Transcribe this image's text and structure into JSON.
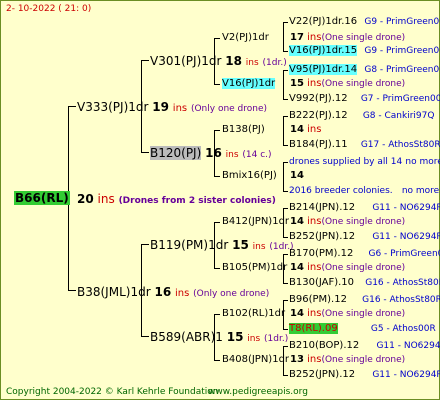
{
  "header": {
    "date": "2- 10-2022 ( 21: 0)"
  },
  "footer": {
    "copyright": "Copyright 2004-2022 © Karl Kehrle Foundation",
    "url": "www.pedigreeapis.org"
  },
  "g1": {
    "name": "B66(RL)",
    "num": "20",
    "ins": "ins",
    "note": "(Drones from 2 sister colonies)"
  },
  "g2": [
    {
      "name": "V333(PJ)1dr",
      "num": "19",
      "ins": "ins",
      "note": "(Only one drone)"
    },
    {
      "name": "B38(JML)1dr",
      "num": "16",
      "ins": "ins",
      "note": "(Only one drone)"
    }
  ],
  "g3": [
    {
      "name": "V301(PJ)1dr",
      "num": "18",
      "ins": "ins",
      "note": "(1dr.)"
    },
    {
      "name": "B120(PJ)",
      "num": "16",
      "ins": "ins",
      "note": "(14 c.)"
    },
    {
      "name": "B119(PM)1dr",
      "num": "15",
      "ins": "ins",
      "note": "(1dr.)"
    },
    {
      "name": "B589(ABR)1",
      "num": "15",
      "ins": "ins",
      "note": "(1dr.)"
    }
  ],
  "g4": [
    {
      "name": "V2(PJ)1dr",
      "num": "17",
      "ins": "ins",
      "note": "(One single drone)"
    },
    {
      "name": "V16(PJ)1dr",
      "num": "15",
      "ins": "ins",
      "note": "(One single drone)"
    },
    {
      "name": "B138(PJ)",
      "num": "14",
      "ins": "ins",
      "note": ""
    },
    {
      "name": "Bmix16(PJ)",
      "num": "14",
      "ins": "",
      "note": ""
    },
    {
      "name": "B412(JPN)1dr",
      "num": "14",
      "ins": "ins",
      "note": "(One single drone)"
    },
    {
      "name": "B105(PM)1dr",
      "num": "14",
      "ins": "ins",
      "note": "(One single drone)"
    },
    {
      "name": "B102(RL)1dr",
      "num": "14",
      "ins": "ins",
      "note": "(One single drone)"
    },
    {
      "name": "B408(JPN)1dr",
      "num": "13",
      "ins": "ins",
      "note": "(One single drone)"
    }
  ],
  "g5": [
    {
      "name": "V22(PJ)1dr.16",
      "code": "G9 - PrimGreen00"
    },
    {
      "name": "V16(PJ)1dr.15",
      "code": "G9 - PrimGreen00"
    },
    {
      "name": "V95(PJ)1dr.14",
      "code": "G8 - PrimGreen00"
    },
    {
      "name": "V992(PJ).12",
      "code": "G7 - PrimGreen00"
    },
    {
      "name": "B222(PJ).12",
      "code": "G8 - Cankiri97Q"
    },
    {
      "name": "B184(PJ).11",
      "code": "G17 - AthosSt80R"
    },
    {
      "name": "drones supplied by all 14",
      "code": "no more"
    },
    {
      "name": "2016 breeder colonies.",
      "code": "no more"
    },
    {
      "name": "B214(JPN).12",
      "code": "G11 - NO6294R"
    },
    {
      "name": "B252(JPN).12",
      "code": "G11 - NO6294R"
    },
    {
      "name": "B170(PM).12",
      "code": "G6 - PrimGreen00"
    },
    {
      "name": "B130(JAF).10",
      "code": "G16 - AthosSt80R"
    },
    {
      "name": "B96(PM).12",
      "code": "G16 - AthosSt80R"
    },
    {
      "name": "T8(RL).09",
      "code": "G5 - Athos00R"
    },
    {
      "name": "B210(BOP).12",
      "code": "G11 - NO6294R"
    },
    {
      "name": "B252(JPN).12",
      "code": "G11 - NO6294R"
    }
  ],
  "colors": {
    "background": "#ffffcc",
    "ins": "#cc0000",
    "note": "#660099",
    "code": "#0000cc",
    "highlight_green": "#33cc33",
    "highlight_cyan": "#66ffff",
    "highlight_grey": "#bbbbbb"
  }
}
